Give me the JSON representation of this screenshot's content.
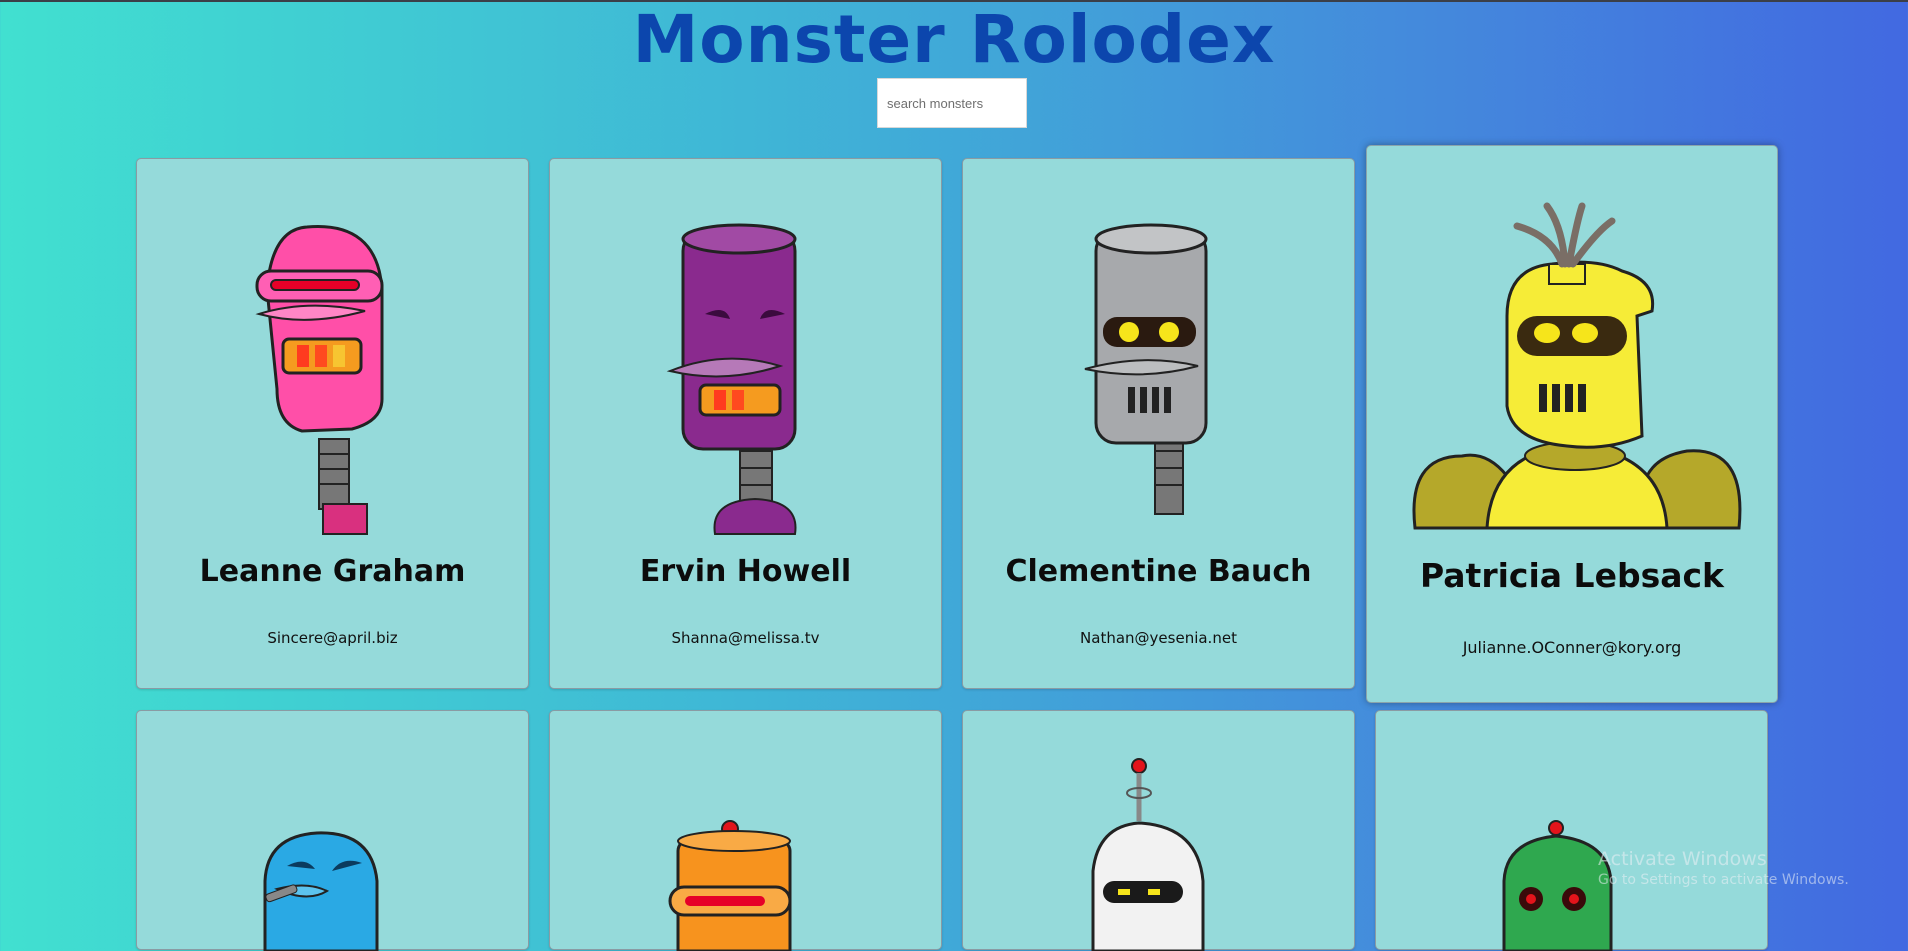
{
  "app": {
    "title": "Monster Rolodex",
    "search": {
      "placeholder": "search monsters",
      "value": ""
    }
  },
  "monsters": [
    {
      "name": "Leanne Graham",
      "email": "Sincere@april.biz",
      "color": "#ff3da0"
    },
    {
      "name": "Ervin Howell",
      "email": "Shanna@melissa.tv",
      "color": "#8a2a8e"
    },
    {
      "name": "Clementine Bauch",
      "email": "Nathan@yesenia.net",
      "color": "#a7a9ac"
    },
    {
      "name": "Patricia Lebsack",
      "email": "Julianne.OConner@kory.org",
      "color": "#f6ec37"
    },
    {
      "name": "",
      "email": "",
      "color": "#2aa9e4"
    },
    {
      "name": "",
      "email": "",
      "color": "#f7931e"
    },
    {
      "name": "",
      "email": "",
      "color": "#f2f2f2"
    },
    {
      "name": "",
      "email": "",
      "color": "#2fa84f"
    }
  ],
  "watermark": {
    "line1": "Activate Windows",
    "line2": "Go to Settings to activate Windows."
  }
}
